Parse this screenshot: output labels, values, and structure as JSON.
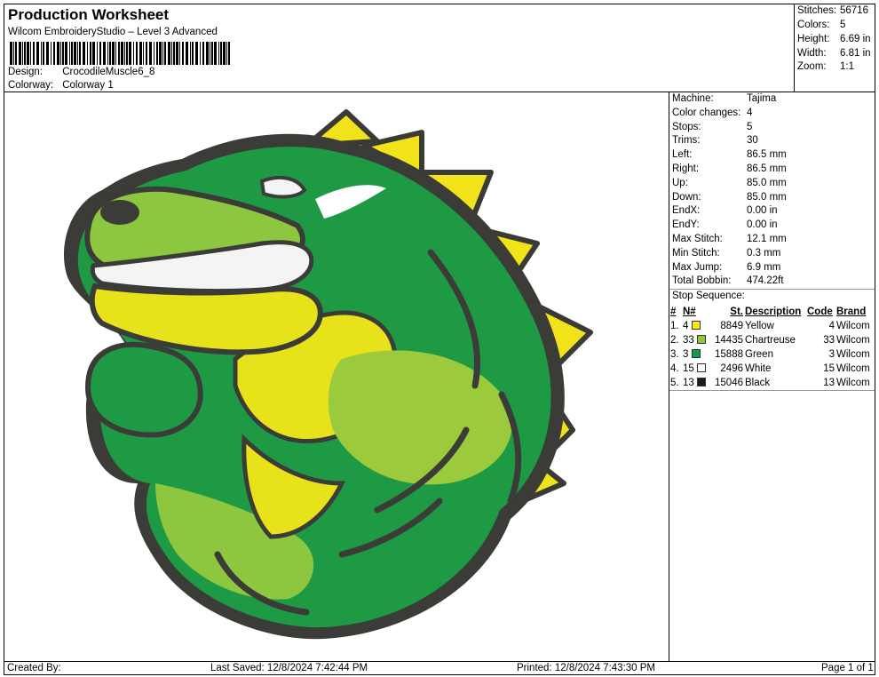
{
  "header": {
    "title": "Production Worksheet",
    "subtitle": "Wilcom EmbroideryStudio – Level 3 Advanced",
    "design_label": "Design:",
    "design_value": "CrocodileMuscle6_8",
    "colorway_label": "Colorway:",
    "colorway_value": "Colorway 1"
  },
  "stats": [
    {
      "k": "Stitches:",
      "v": "56716"
    },
    {
      "k": "Colors:",
      "v": "5"
    },
    {
      "k": "Height:",
      "v": "6.69 in"
    },
    {
      "k": "Width:",
      "v": "6.81 in"
    },
    {
      "k": "Zoom:",
      "v": "1:1"
    }
  ],
  "machine_info": [
    {
      "k": "Machine:",
      "v": "Tajima"
    },
    {
      "k": "Color changes:",
      "v": "4"
    },
    {
      "k": "Stops:",
      "v": "5"
    },
    {
      "k": "Trims:",
      "v": "30"
    },
    {
      "k": "Left:",
      "v": "86.5 mm"
    },
    {
      "k": "Right:",
      "v": "86.5 mm"
    },
    {
      "k": "Up:",
      "v": "85.0 mm"
    },
    {
      "k": "Down:",
      "v": "85.0 mm"
    },
    {
      "k": "EndX:",
      "v": "0.00 in"
    },
    {
      "k": "EndY:",
      "v": "0.00 in"
    },
    {
      "k": "Max Stitch:",
      "v": "12.1 mm"
    },
    {
      "k": "Min Stitch:",
      "v": "0.3 mm"
    },
    {
      "k": "Max Jump:",
      "v": "6.9 mm"
    },
    {
      "k": "Total Bobbin:",
      "v": "474.22ft"
    }
  ],
  "stop_sequence": {
    "title": "Stop Sequence:",
    "headers": {
      "num": "#",
      "n": "N#",
      "st": "St.",
      "desc": "Description",
      "code": "Code",
      "brand": "Brand"
    },
    "rows": [
      {
        "num": "1.",
        "n": "4",
        "color": "#FFE800",
        "st": "8849",
        "desc": "Yellow",
        "code": "4",
        "brand": "Wilcom"
      },
      {
        "num": "2.",
        "n": "33",
        "color": "#8DC63F",
        "st": "14435",
        "desc": "Chartreuse",
        "code": "33",
        "brand": "Wilcom"
      },
      {
        "num": "3.",
        "n": "3",
        "color": "#119A48",
        "st": "15888",
        "desc": "Green",
        "code": "3",
        "brand": "Wilcom"
      },
      {
        "num": "4.",
        "n": "15",
        "color": "#FFFFFF",
        "st": "2496",
        "desc": "White",
        "code": "15",
        "brand": "Wilcom"
      },
      {
        "num": "5.",
        "n": "13",
        "color": "#1A1A1A",
        "st": "15046",
        "desc": "Black",
        "code": "13",
        "brand": "Wilcom"
      }
    ]
  },
  "footer": {
    "created_by": "Created By:",
    "last_saved": "Last Saved: 12/8/2024 7:42:44 PM",
    "printed": "Printed: 12/8/2024 7:43:30 PM",
    "page": "Page 1 of 1"
  }
}
